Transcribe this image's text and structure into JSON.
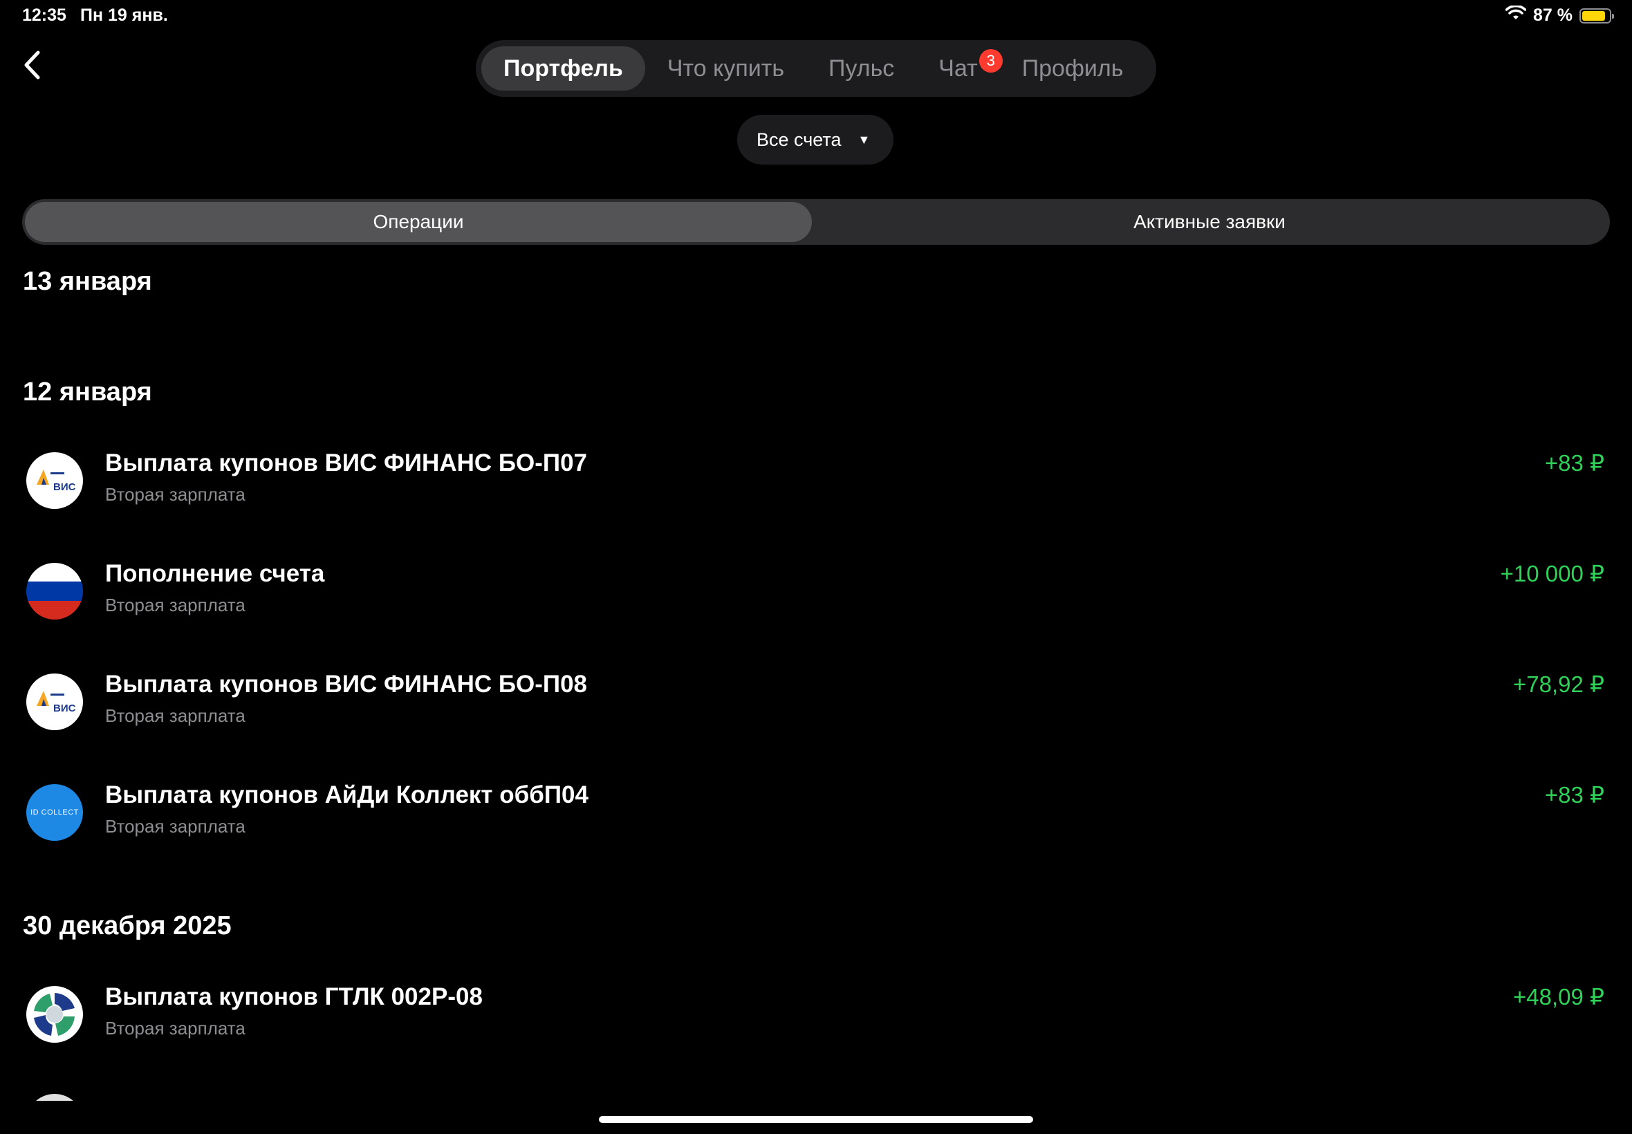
{
  "status_bar": {
    "time": "12:35",
    "date": "Пн 19 янв.",
    "battery_text": "87 %",
    "battery_level": 0.87,
    "battery_color": "#ffd60a"
  },
  "top_tabs": [
    {
      "label": "Портфель",
      "active": true
    },
    {
      "label": "Что купить"
    },
    {
      "label": "Пульс"
    },
    {
      "label": "Чат",
      "badge": "3"
    },
    {
      "label": "Профиль"
    }
  ],
  "account_select": {
    "label": "Все счета"
  },
  "segments": {
    "operations": "Операции",
    "active_orders": "Активные заявки"
  },
  "groups": [
    {
      "date": "13 января"
    },
    {
      "date": "12 января"
    },
    {
      "date": "30 декабря 2025"
    }
  ],
  "operations": [
    {
      "title": "Выплата купонов ВИС ФИНАНС БО-П07",
      "subtitle": "Вторая зарплата",
      "amount": "+83 ₽",
      "logo": "vis-logo"
    },
    {
      "title": "Пополнение счета",
      "subtitle": "Вторая зарплата",
      "amount": "+10 000 ₽",
      "logo": "russia-flag-icon"
    },
    {
      "title": "Выплата купонов ВИС ФИНАНС БО-П08",
      "subtitle": "Вторая зарплата",
      "amount": "+78,92 ₽",
      "logo": "vis-logo"
    },
    {
      "title": "Выплата купонов АйДи Коллект оббП04",
      "subtitle": "Вторая зарплата",
      "amount": "+83 ₽",
      "logo": "id-collect-logo",
      "logo_text": "ID COLLECT"
    },
    {
      "title": "Выплата купонов ГТЛК 002Р-08",
      "subtitle": "Вторая зарплата",
      "amount": "+48,09 ₽",
      "logo": "gtlk-logo"
    }
  ],
  "colors": {
    "positive": "#30d158",
    "badge": "#ff3b30",
    "background": "#000000"
  }
}
